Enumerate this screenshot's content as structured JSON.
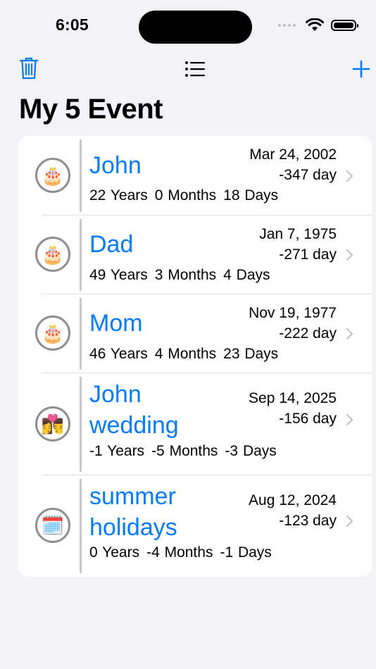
{
  "status": {
    "time": "6:05"
  },
  "nav": {
    "title": "My 5 Event"
  },
  "events": [
    {
      "name": "John",
      "date": "Mar 24, 2002",
      "days": "-347 day",
      "years": "22 Years",
      "months": "0 Months",
      "dd": "18 Days",
      "icon": "birthday-cake-icon"
    },
    {
      "name": "Dad",
      "date": "Jan 7, 1975",
      "days": "-271 day",
      "years": "49 Years",
      "months": "3 Months",
      "dd": "4 Days",
      "icon": "birthday-cake-icon"
    },
    {
      "name": "Mom",
      "date": "Nov 19, 1977",
      "days": "-222 day",
      "years": "46 Years",
      "months": "4 Months",
      "dd": "23 Days",
      "icon": "birthday-cake-icon"
    },
    {
      "name_line1": "John",
      "name_line2": "wedding",
      "date": "Sep 14, 2025",
      "days": "-156 day",
      "years": "-1 Years",
      "months": "-5 Months",
      "dd": "-3 Days",
      "icon": "couple-kiss-icon"
    },
    {
      "name_line1": "summer",
      "name_line2": "holidays",
      "date": "Aug 12, 2024",
      "days": "-123 day",
      "years": "0 Years",
      "months": "-4 Months",
      "dd": "-1 Days",
      "icon": "calendar-icon"
    }
  ],
  "colors": {
    "accent": "#007AFF",
    "background": "#F2F2F7"
  }
}
